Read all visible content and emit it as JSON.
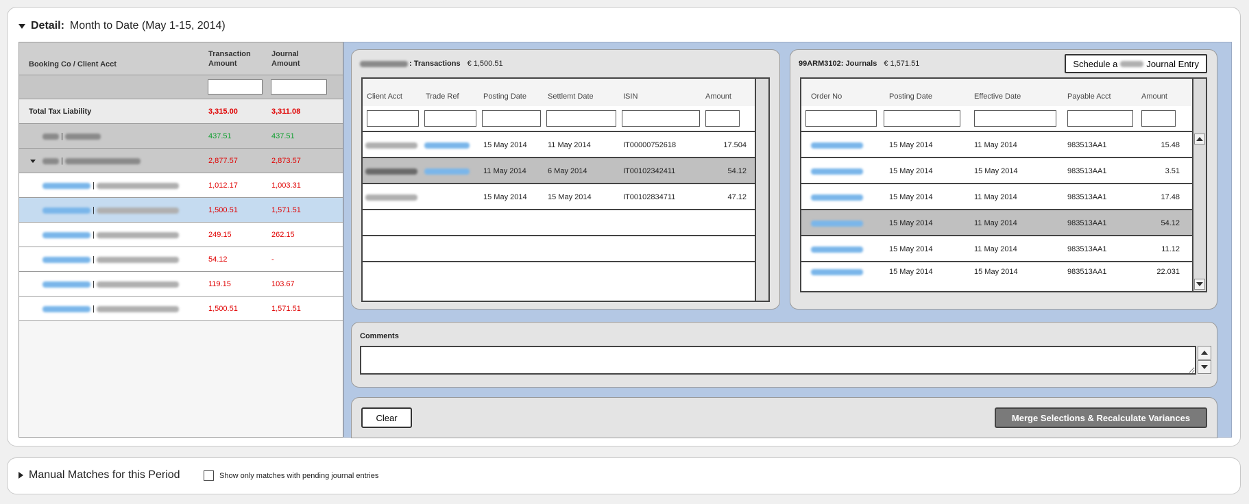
{
  "detail": {
    "label_bold": "Detail:",
    "label_rest": "Month to Date (May 1-15, 2014)"
  },
  "left_table": {
    "headers": {
      "booking": "Booking Co / Client Acct",
      "transaction_amount": "Transaction Amount",
      "journal_amount": "Journal Amount"
    },
    "total": {
      "label": "Total Tax Liability",
      "transaction": "3,315.00",
      "journal": "3,311.08"
    },
    "rows": [
      {
        "transaction": "437.51",
        "journal": "437.51"
      },
      {
        "transaction": "2,877.57",
        "journal": "2,873.57"
      },
      {
        "transaction": "1,012.17",
        "journal": "1,003.31"
      },
      {
        "transaction": "1,500.51",
        "journal": "1,571.51"
      },
      {
        "transaction": "249.15",
        "journal": "262.15"
      },
      {
        "transaction": "54.12",
        "journal": "-"
      },
      {
        "transaction": "119.15",
        "journal": "103.67"
      },
      {
        "transaction": "1,500.51",
        "journal": "1,571.51"
      }
    ]
  },
  "transactions": {
    "title": ": Transactions",
    "amount": "€ 1,500.51",
    "headers": {
      "client_acct": "Client Acct",
      "trade_ref": "Trade Ref",
      "posting_date": "Posting Date",
      "settlement_date": "Settlemt Date",
      "isin": "ISIN",
      "amount": "Amount"
    },
    "rows": [
      {
        "posting": "15 May 2014",
        "settle": "11 May 2014",
        "isin": "IT00000752618",
        "amount": "17.504"
      },
      {
        "posting": "11 May 2014",
        "settle": "6 May 2014",
        "isin": "IT00102342411",
        "amount": "54.12"
      },
      {
        "posting": "15 May 2014",
        "settle": "15 May 2014",
        "isin": "IT00102834711",
        "amount": "47.12"
      }
    ]
  },
  "journals": {
    "title": "99ARM3102: Journals",
    "amount": "€ 1,571.51",
    "schedule_pre": "Schedule a",
    "schedule_post": "Journal Entry",
    "headers": {
      "order_no": "Order No",
      "posting_date": "Posting Date",
      "effective_date": "Effective Date",
      "payable_acct": "Payable Acct",
      "amount": "Amount"
    },
    "rows": [
      {
        "posting": "15 May 2014",
        "effective": "11 May 2014",
        "payable": "983513AA1",
        "amount": "15.48"
      },
      {
        "posting": "15 May 2014",
        "effective": "15 May 2014",
        "payable": "983513AA1",
        "amount": "3.51"
      },
      {
        "posting": "15 May 2014",
        "effective": "11 May 2014",
        "payable": "983513AA1",
        "amount": "17.48"
      },
      {
        "posting": "15 May 2014",
        "effective": "11 May 2014",
        "payable": "983513AA1",
        "amount": "54.12"
      },
      {
        "posting": "15 May 2014",
        "effective": "11 May 2014",
        "payable": "983513AA1",
        "amount": "11.12"
      },
      {
        "posting": "15 May 2014",
        "effective": "15 May 2014",
        "payable": "983513AA1",
        "amount": "22.031"
      }
    ]
  },
  "comments": {
    "label": "Comments"
  },
  "actions": {
    "clear": "Clear",
    "merge": "Merge Selections & Recalculate Variances"
  },
  "manual": {
    "label": "Manual Matches for this Period",
    "checkbox_label": "Show only matches with pending journal entries"
  }
}
